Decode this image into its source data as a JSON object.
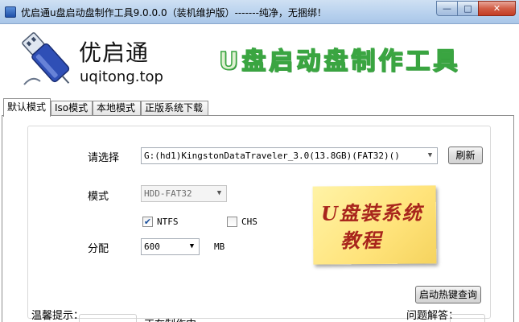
{
  "window": {
    "title": "优启通u盘启动盘制作工具9.0.0.0（装机维护版）-------纯净，无捆绑！",
    "minimize": "—",
    "maximize": "□",
    "close": "✕"
  },
  "header": {
    "brand_name": "优启通",
    "brand_url": "uqitong.top",
    "slogan": "U盘启动盘制作工具"
  },
  "tabs": [
    {
      "label": "默认模式",
      "active": true
    },
    {
      "label": "Iso模式",
      "active": false
    },
    {
      "label": "本地模式",
      "active": false
    },
    {
      "label": "正版系统下载",
      "active": false
    }
  ],
  "form": {
    "select_label": "请选择",
    "drive_value": "G:(hd1)KingstonDataTraveler_3.0(13.8GB)(FAT32)()",
    "refresh_label": "刷新",
    "mode_label": "模式",
    "mode_value": "HDD-FAT32",
    "ntfs_label": "NTFS",
    "ntfs_checked": true,
    "chs_label": "CHS",
    "chs_checked": false,
    "alloc_label": "分配",
    "alloc_value": "600",
    "alloc_unit": "MB",
    "hotkey_button": "启动热键查询"
  },
  "note": {
    "line1": "U盘装系统",
    "line2": "教程"
  },
  "bottom": {
    "tips_label": "温馨提示：",
    "middle_partial": "正在制作中",
    "qa_label": "问题解答："
  },
  "colors": {
    "slogan_green": "#3aa541",
    "note_red": "#a8251c",
    "note_yellow": "#ffe37a"
  }
}
